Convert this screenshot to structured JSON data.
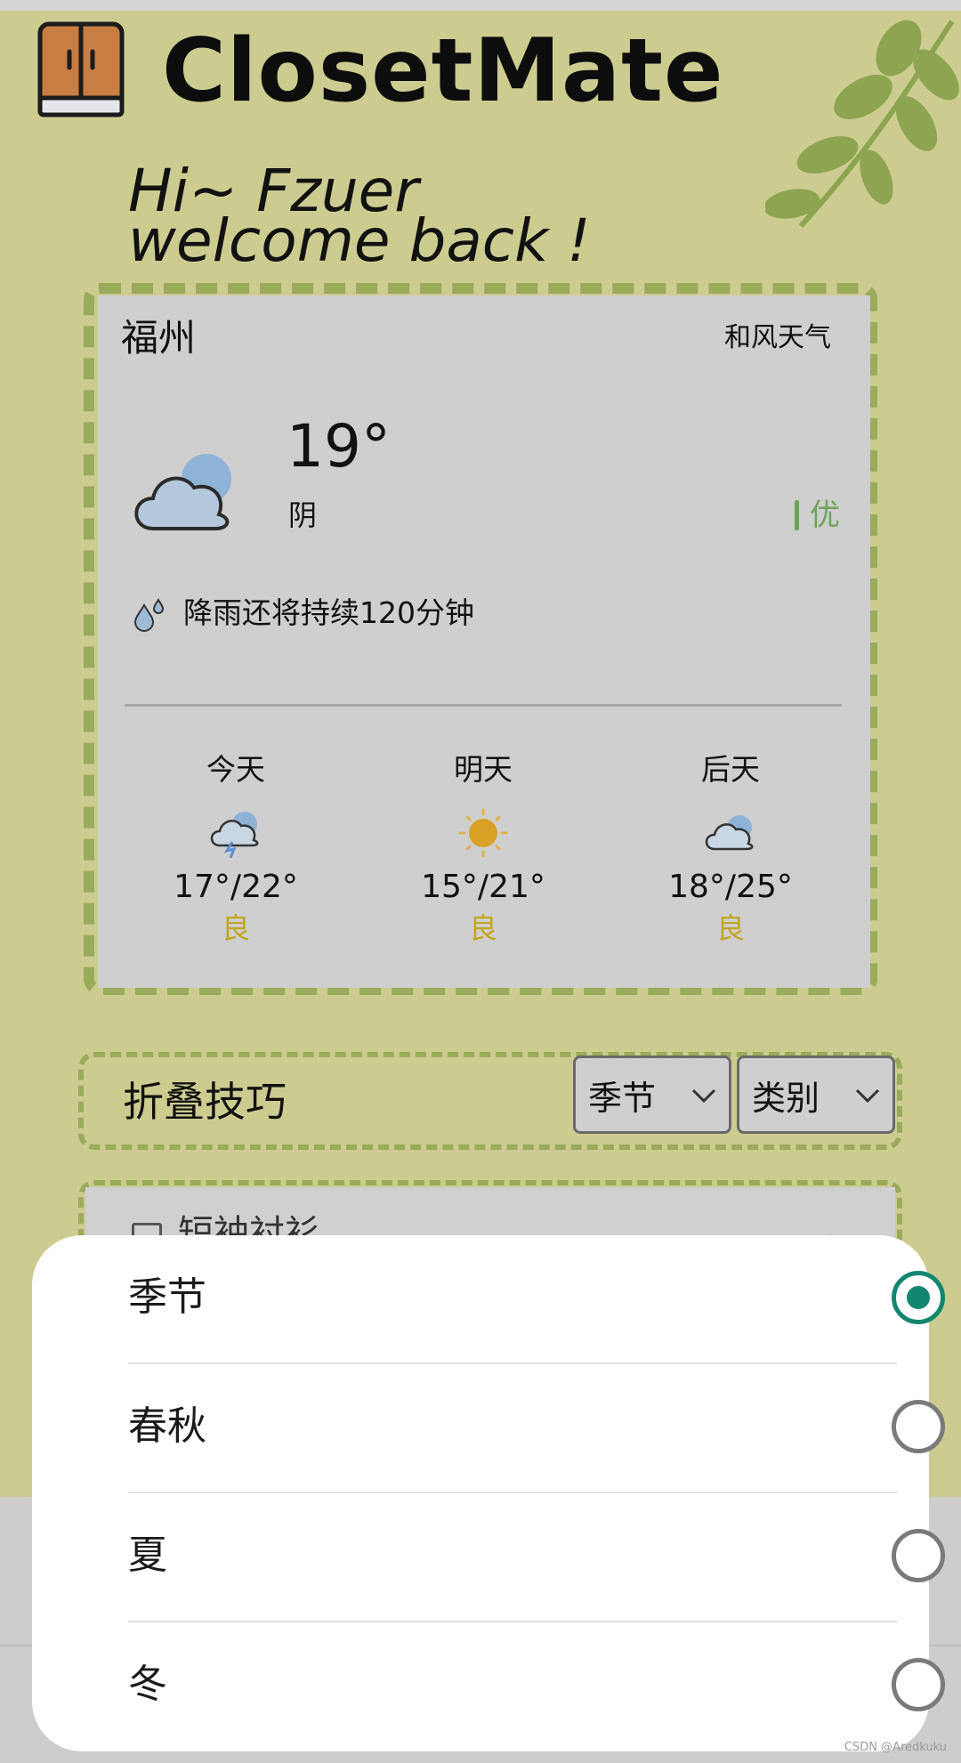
{
  "app": {
    "title": "ClosetMate"
  },
  "greeting": {
    "line1": "Hi~ Fzuer",
    "line2": "welcome back !"
  },
  "weather": {
    "city": "福州",
    "provider": "和风天气",
    "current_temp": "19°",
    "current_condition": "阴",
    "air_quality": "优",
    "rain_notice": "降雨还将持续120分钟",
    "forecast": [
      {
        "day": "今天",
        "range": "17°/22°",
        "aqi": "良",
        "icon": "thunder-rain-icon"
      },
      {
        "day": "明天",
        "range": "15°/21°",
        "aqi": "良",
        "icon": "sun-icon"
      },
      {
        "day": "后天",
        "range": "18°/25°",
        "aqi": "良",
        "icon": "cloudy-icon"
      }
    ]
  },
  "folding": {
    "title": "折叠技巧",
    "filters": [
      {
        "label": "季节"
      },
      {
        "label": "类别"
      }
    ],
    "list": [
      {
        "label": "短袖衬衫"
      }
    ]
  },
  "sheet": {
    "options": [
      {
        "label": "季节",
        "selected": true
      },
      {
        "label": "春秋",
        "selected": false
      },
      {
        "label": "夏",
        "selected": false
      },
      {
        "label": "冬",
        "selected": false
      }
    ]
  },
  "watermark": "CSDN @Aredkuku",
  "colors": {
    "background": "#cccc90",
    "dashed_border": "#9aab5c",
    "card": "#cfcfcf",
    "aqi_good": "#6ea35a",
    "aqi_moderate": "#c4a41c",
    "radio_selected": "#13866f"
  }
}
